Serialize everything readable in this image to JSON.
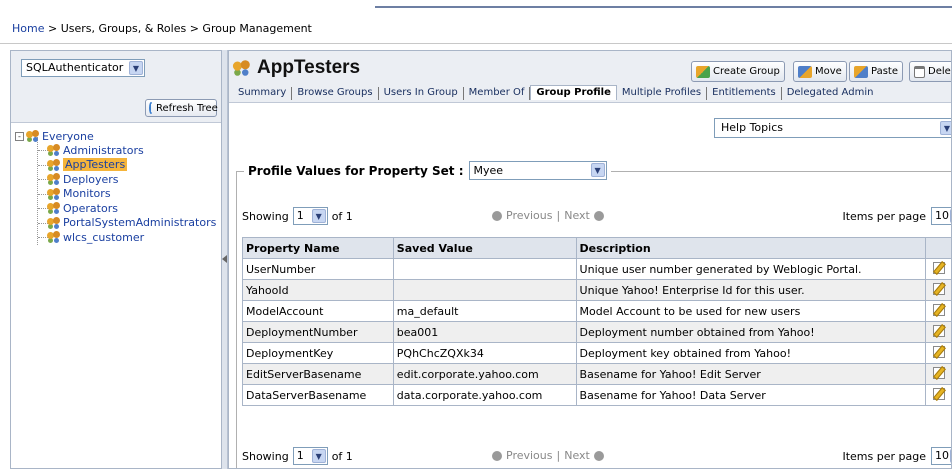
{
  "breadcrumb": {
    "home": "Home",
    "rest": " > Users, Groups, & Roles > Group Management"
  },
  "left": {
    "authenticator": "SQLAuthenticator",
    "refresh_label": "Refresh Tree",
    "tree": {
      "root": "Everyone",
      "root_expander": "-",
      "children": [
        {
          "label": "Administrators",
          "selected": false
        },
        {
          "label": "AppTesters",
          "selected": true
        },
        {
          "label": "Deployers",
          "selected": false
        },
        {
          "label": "Monitors",
          "selected": false
        },
        {
          "label": "Operators",
          "selected": false
        },
        {
          "label": "PortalSystemAdministrators",
          "selected": false
        },
        {
          "label": "wlcs_customer",
          "selected": false
        }
      ]
    }
  },
  "header": {
    "title": "AppTesters",
    "buttons": {
      "create": "Create Group",
      "move": "Move",
      "paste": "Paste",
      "delete": "Delet"
    },
    "tabs": [
      "Summary",
      "Browse Groups",
      "Users In Group",
      "Member Of",
      "Group Profile",
      "Multiple Profiles",
      "Entitlements",
      "Delegated Admin"
    ],
    "active_tab": "Group Profile"
  },
  "help": {
    "value": "Help Topics"
  },
  "profile": {
    "legend": "Profile Values for Property Set :",
    "property_set": "Myee"
  },
  "pager": {
    "showing": "Showing",
    "page": "1",
    "of": "of 1",
    "previous": "Previous",
    "sep": "|",
    "next": "Next",
    "items_label": "Items per page",
    "items_value": "10"
  },
  "table": {
    "columns": [
      "Property Name",
      "Saved Value",
      "Description",
      ""
    ],
    "rows": [
      {
        "name": "UserNumber",
        "value": "",
        "desc": "Unique user number generated by Weblogic Portal."
      },
      {
        "name": "YahooId",
        "value": "",
        "desc": "Unique Yahoo! Enterprise Id for this user."
      },
      {
        "name": "ModelAccount",
        "value": "ma_default",
        "desc": "Model Account to be used for new users"
      },
      {
        "name": "DeploymentNumber",
        "value": "bea001",
        "desc": "Deployment number obtained from Yahoo!"
      },
      {
        "name": "DeploymentKey",
        "value": "PQhChcZQXk34",
        "desc": "Deployment key obtained from Yahoo!"
      },
      {
        "name": "EditServerBasename",
        "value": "edit.corporate.yahoo.com",
        "desc": "Basename for Yahoo! Edit Server"
      },
      {
        "name": "DataServerBasename",
        "value": "data.corporate.yahoo.com",
        "desc": "Basename for Yahoo! Data Server"
      }
    ]
  },
  "colors": {
    "link": "#1a3fa0",
    "selected_bg": "#f5b43a",
    "panel_bg": "#ebeef3",
    "header_bg": "#dfe4ec"
  }
}
